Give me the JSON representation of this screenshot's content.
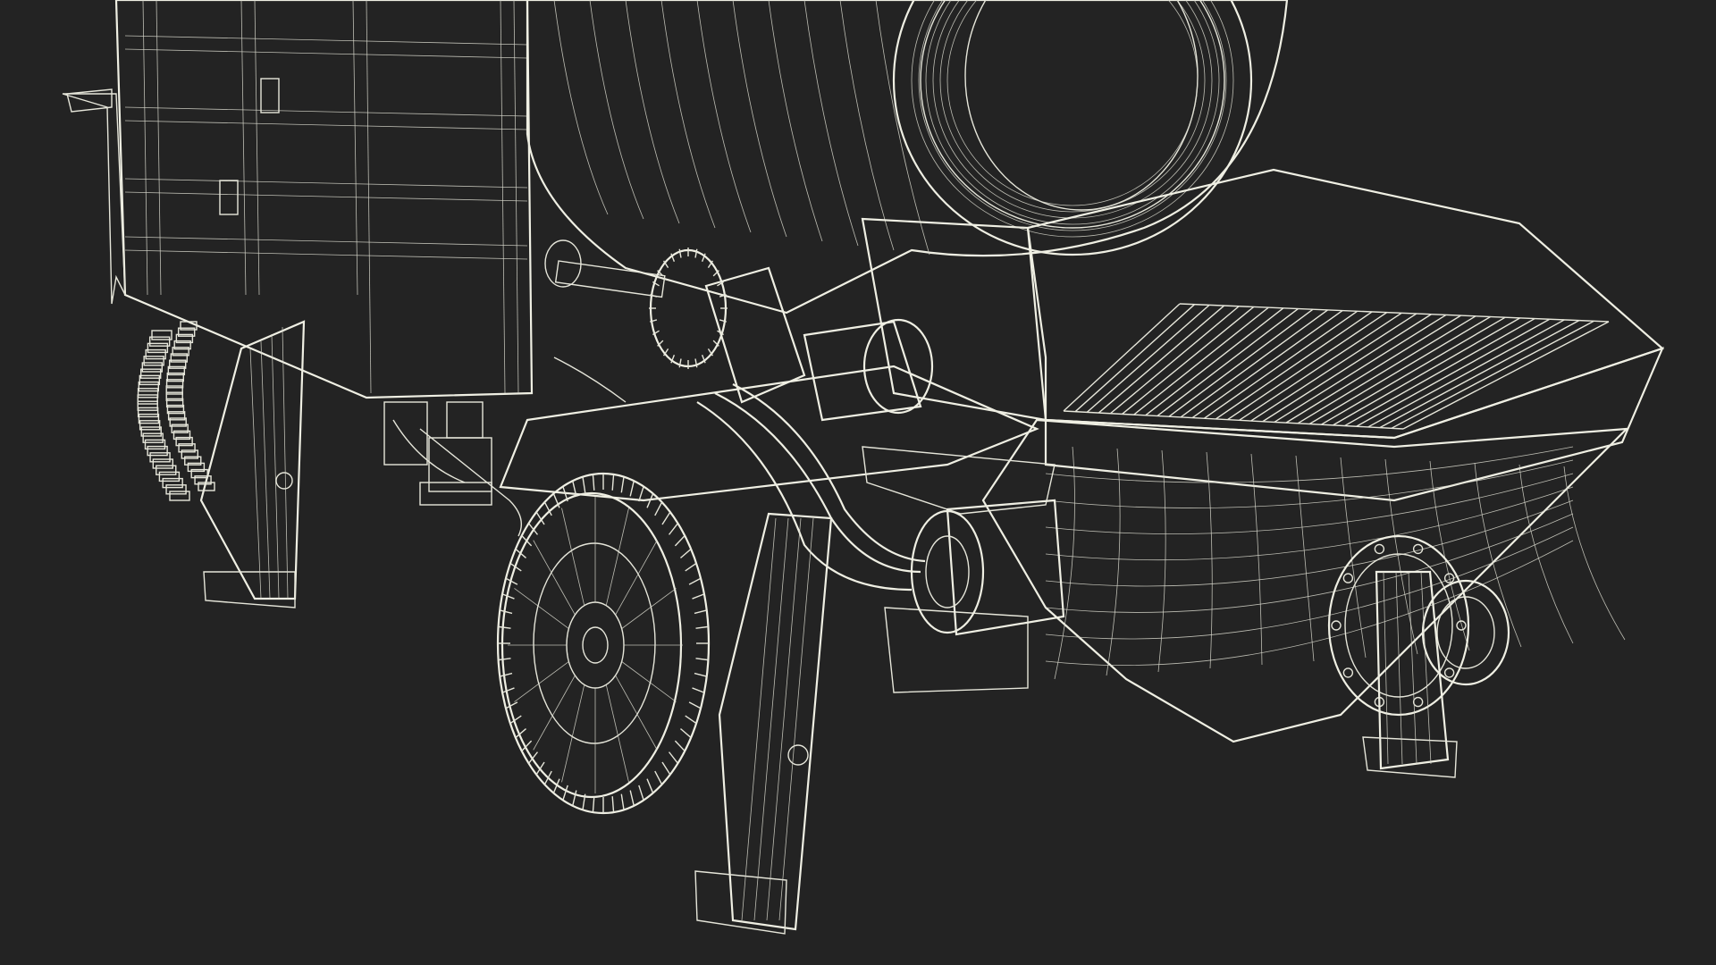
{
  "scene": {
    "subject": "wireframe-render",
    "background_color": "#232323",
    "mesh_fill_color": "#6c6d66",
    "wire_color": "#e6e6da"
  }
}
